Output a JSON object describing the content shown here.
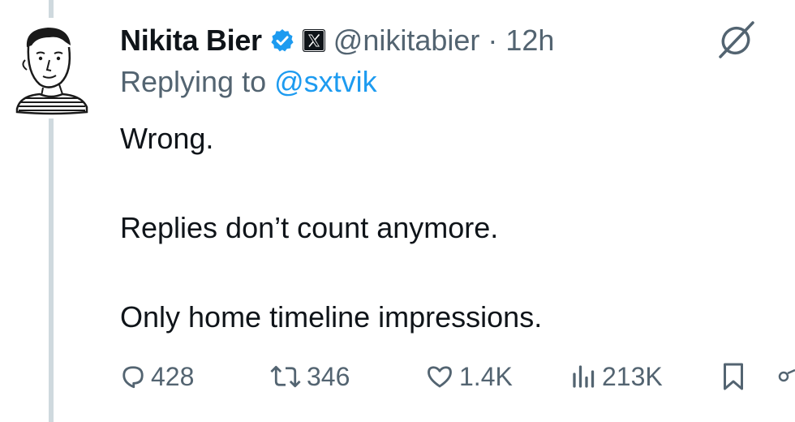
{
  "tweet": {
    "author_name": "Nikita Bier",
    "handle_time": "@nikitabier · 12h",
    "replying_prefix": "Replying to ",
    "replying_to": "@sxtvik",
    "lines": [
      "Wrong.",
      "Replies don’t count anymore.",
      "Only home timeline impressions."
    ]
  },
  "actions": {
    "replies": "428",
    "reposts": "346",
    "likes": "1.4K",
    "views": "213K"
  },
  "icons": {
    "verified": "verified-badge-icon",
    "affiliate": "x-logo-icon",
    "grok": "grok-icon",
    "reply": "reply-icon",
    "repost": "repost-icon",
    "like": "heart-icon",
    "views": "analytics-icon",
    "bookmark": "bookmark-icon",
    "share": "share-icon"
  },
  "colors": {
    "link": "#1d9bf0",
    "secondary": "#536471",
    "text": "#0f1419"
  }
}
